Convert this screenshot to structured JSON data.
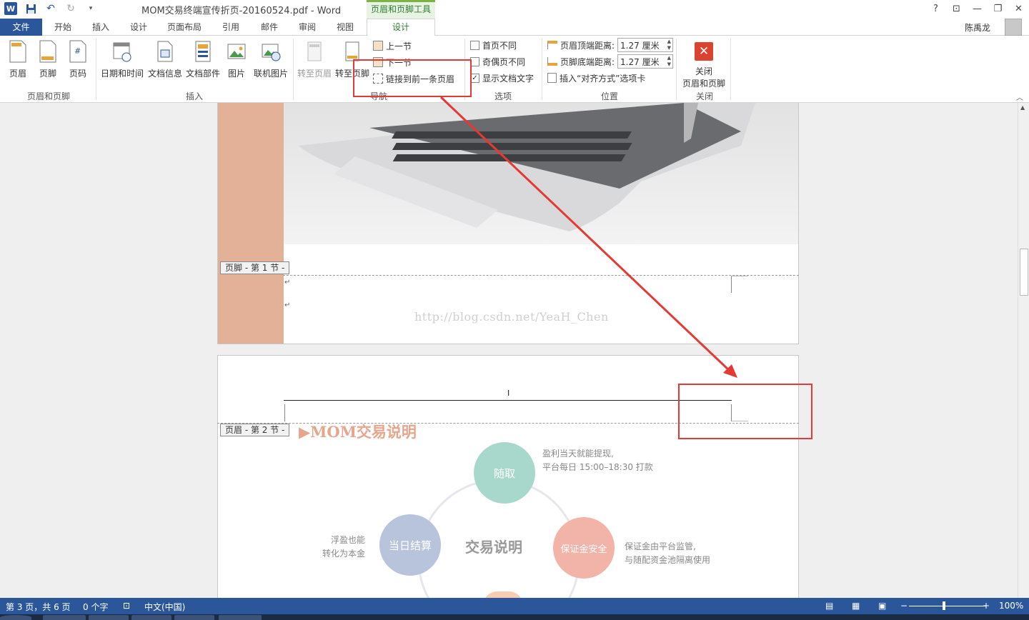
{
  "titlebar": {
    "doc_title": "MOM交易终端宣传折页-20160524.pdf - Word",
    "context_group": "页眉和页脚工具",
    "help": "?",
    "restore_ribbon": "⊡",
    "minimize": "—",
    "maximize": "❐",
    "close": "✕"
  },
  "tabs": {
    "file": "文件",
    "home": "开始",
    "insert": "插入",
    "design": "设计",
    "layout": "页面布局",
    "references": "引用",
    "mailings": "邮件",
    "review": "审阅",
    "view": "视图",
    "hf_design": "设计",
    "user": "陈禹龙"
  },
  "ribbon": {
    "header": "页眉",
    "footer": "页脚",
    "page_number": "页码",
    "group_hf": "页眉和页脚",
    "date_time": "日期和时间",
    "doc_info": "文档信息",
    "quick_parts": "文档部件",
    "picture": "图片",
    "online_picture": "联机图片",
    "group_insert": "插入",
    "goto_header": "转至页眉",
    "goto_footer": "转至页脚",
    "prev_section": "上一节",
    "next_section": "下一节",
    "link_to_previous": "链接到前一条页眉",
    "group_nav": "导航",
    "diff_first_page": "首页不同",
    "diff_odd_even": "奇偶页不同",
    "show_doc_text": "显示文档文字",
    "group_options": "选项",
    "header_from_top_label": "页眉顶端距离:",
    "header_from_top_value": "1.27 厘米",
    "footer_from_bottom_label": "页脚底端距离:",
    "footer_from_bottom_value": "1.27 厘米",
    "insert_align_tab": "插入“对齐方式”选项卡",
    "group_position": "位置",
    "close_hf_line1": "关闭",
    "close_hf_line2": "页眉和页脚",
    "group_close": "关闭"
  },
  "document": {
    "footer_tag": "页脚 - 第 1 节 -",
    "header_tag": "页眉 - 第 2 节 -",
    "watermark": "http://blog.csdn.net/YeaH_Chen",
    "section_heading": "▶MOM交易说明",
    "center_label": "交易说明",
    "bubbles": {
      "suiqu": "随取",
      "dangri": "当日结算",
      "baozheng": "保证金安全"
    },
    "notes": {
      "top_line1": "盈利当天就能提现,",
      "top_line2": "平台每日 15:00–18:30 打款",
      "left_line1": "浮盈也能",
      "left_line2": "转化为本金",
      "right_line1": "保证金由平台监管,",
      "right_line2": "与随配资金池隔离使用"
    },
    "colors": {
      "band": "#e3b098",
      "bubble_teal": "#a8d8cc",
      "bubble_blue": "#b8c4dc",
      "bubble_pink": "#f2b3a8",
      "annotation": "#e53935"
    }
  },
  "status": {
    "page_info": "第 3 页，共 6 页",
    "word_count": "0 个字",
    "language": "中文(中国)",
    "zoom": "100%",
    "zoom_out": "−",
    "zoom_in": "+"
  }
}
